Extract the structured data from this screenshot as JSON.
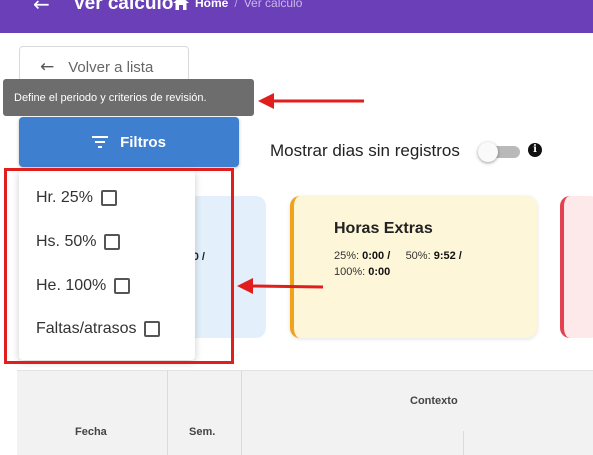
{
  "header": {
    "title": "Ver cálculo",
    "breadcrumb_home": "Home",
    "breadcrumb_separator": "/",
    "breadcrumb_current": "Ver cálculo",
    "background_color": "#6a3fb8"
  },
  "back_button": {
    "label": "Volver a lista"
  },
  "tooltip": {
    "text": "Define el periodo y criterios de revisión."
  },
  "filters_button": {
    "label": "Filtros",
    "color": "#3f7fcf"
  },
  "toggle": {
    "label": "Mostrar dias sin registros",
    "checked": false
  },
  "filter_menu": {
    "items": [
      {
        "label": "Hr. 25%",
        "checked": false
      },
      {
        "label": "Hs. 50%",
        "checked": false
      },
      {
        "label": "He. 100%",
        "checked": false
      },
      {
        "label": "Faltas/atrasos",
        "checked": false
      }
    ]
  },
  "cards": {
    "partial_text": ": 0 /",
    "horas_extras": {
      "title": "Horas Extras",
      "p25_label": "25%:",
      "p25_value": "0:00 /",
      "p50_label": "50%:",
      "p50_value": "9:52 /",
      "p100_label": "100%:",
      "p100_value": "0:00",
      "accent_color": "#f0a21a"
    },
    "red_accent_color": "#e5404f"
  },
  "table": {
    "headers": {
      "fecha": "Fecha",
      "sem": "Sem.",
      "contexto": "Contexto"
    }
  },
  "annotations": {
    "color": "#e01e1e"
  }
}
